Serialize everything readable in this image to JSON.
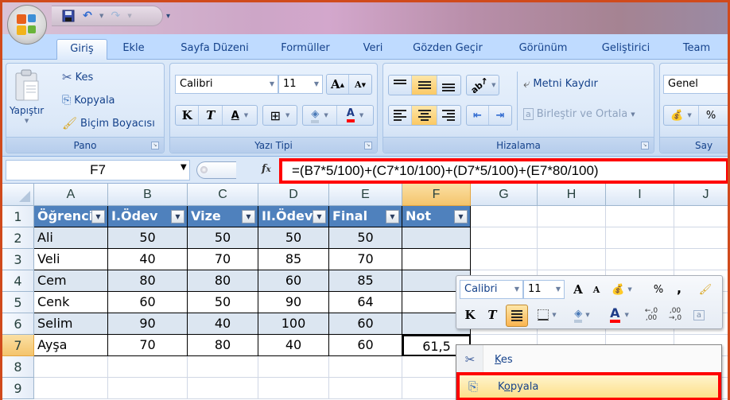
{
  "quick_access": {
    "icons": [
      "office-button",
      "save-icon",
      "undo-icon",
      "redo-icon",
      "customize-icon"
    ]
  },
  "tabs": [
    {
      "label": "Giriş",
      "active": true
    },
    {
      "label": "Ekle"
    },
    {
      "label": "Sayfa Düzeni"
    },
    {
      "label": "Formüller"
    },
    {
      "label": "Veri"
    },
    {
      "label": "Gözden Geçir"
    },
    {
      "label": "Görünüm"
    },
    {
      "label": "Geliştirici"
    },
    {
      "label": "Team"
    }
  ],
  "ribbon": {
    "pano": {
      "label": "Pano",
      "paste": "Yapıştır",
      "cut": "Kes",
      "copy": "Kopyala",
      "format_painter": "Biçim Boyacısı"
    },
    "font": {
      "label": "Yazı Tipi",
      "font_name": "Calibri",
      "font_size": "11",
      "bold": "K",
      "italic": "T",
      "underline": "A",
      "grow": "A",
      "shrink": "A",
      "font_color": "A",
      "font_color_hex": "#ff0000"
    },
    "alignment": {
      "label": "Hizalama",
      "wrap_text": "Metni Kaydır",
      "merge_center": "Birleştir ve Ortala"
    },
    "number": {
      "label_partial": "Say",
      "format": "Genel",
      "percent": "%"
    }
  },
  "formula_bar": {
    "name_box": "F7",
    "fx": "fx",
    "formula": "=(B7*5/100)+(C7*10/100)+(D7*5/100)+(E7*80/100)"
  },
  "sheet": {
    "columns": [
      "A",
      "B",
      "C",
      "D",
      "E",
      "F",
      "G",
      "H",
      "I",
      "J"
    ],
    "selected_column": "F",
    "rows": [
      "1",
      "2",
      "3",
      "4",
      "5",
      "6",
      "7",
      "8",
      "9"
    ],
    "selected_row": "7",
    "table_headers": [
      "Öğrenci",
      "I.Ödev",
      "Vize",
      "II.Ödev",
      "Final",
      "Not"
    ],
    "table_rows": [
      [
        "Ali",
        "50",
        "50",
        "50",
        "50",
        ""
      ],
      [
        "Veli",
        "40",
        "70",
        "85",
        "70",
        ""
      ],
      [
        "Cem",
        "80",
        "80",
        "60",
        "85",
        ""
      ],
      [
        "Cenk",
        "60",
        "50",
        "90",
        "64",
        ""
      ],
      [
        "Selim",
        "90",
        "40",
        "100",
        "60",
        ""
      ],
      [
        "Ayşa",
        "70",
        "80",
        "40",
        "60",
        "61,5"
      ]
    ],
    "header_color": "#4f81bd",
    "band_color": "#dce6f1"
  },
  "mini_toolbar": {
    "font_name": "Calibri",
    "font_size": "11",
    "grow": "A",
    "shrink": "A",
    "percent": "%",
    "comma": ",",
    "bold": "K",
    "italic": "T",
    "font_color": "A",
    "inc_decimal": "←,0 ,00",
    "dec_decimal": ",00 →,0"
  },
  "context_menu": {
    "items": [
      {
        "label": "Kes",
        "mnemonic": "K",
        "icon": "scissors-icon"
      },
      {
        "label": "Kopyala",
        "mnemonic": "o",
        "icon": "copy-icon",
        "highlighted": true
      }
    ]
  },
  "highlight_color": "#ff0000"
}
